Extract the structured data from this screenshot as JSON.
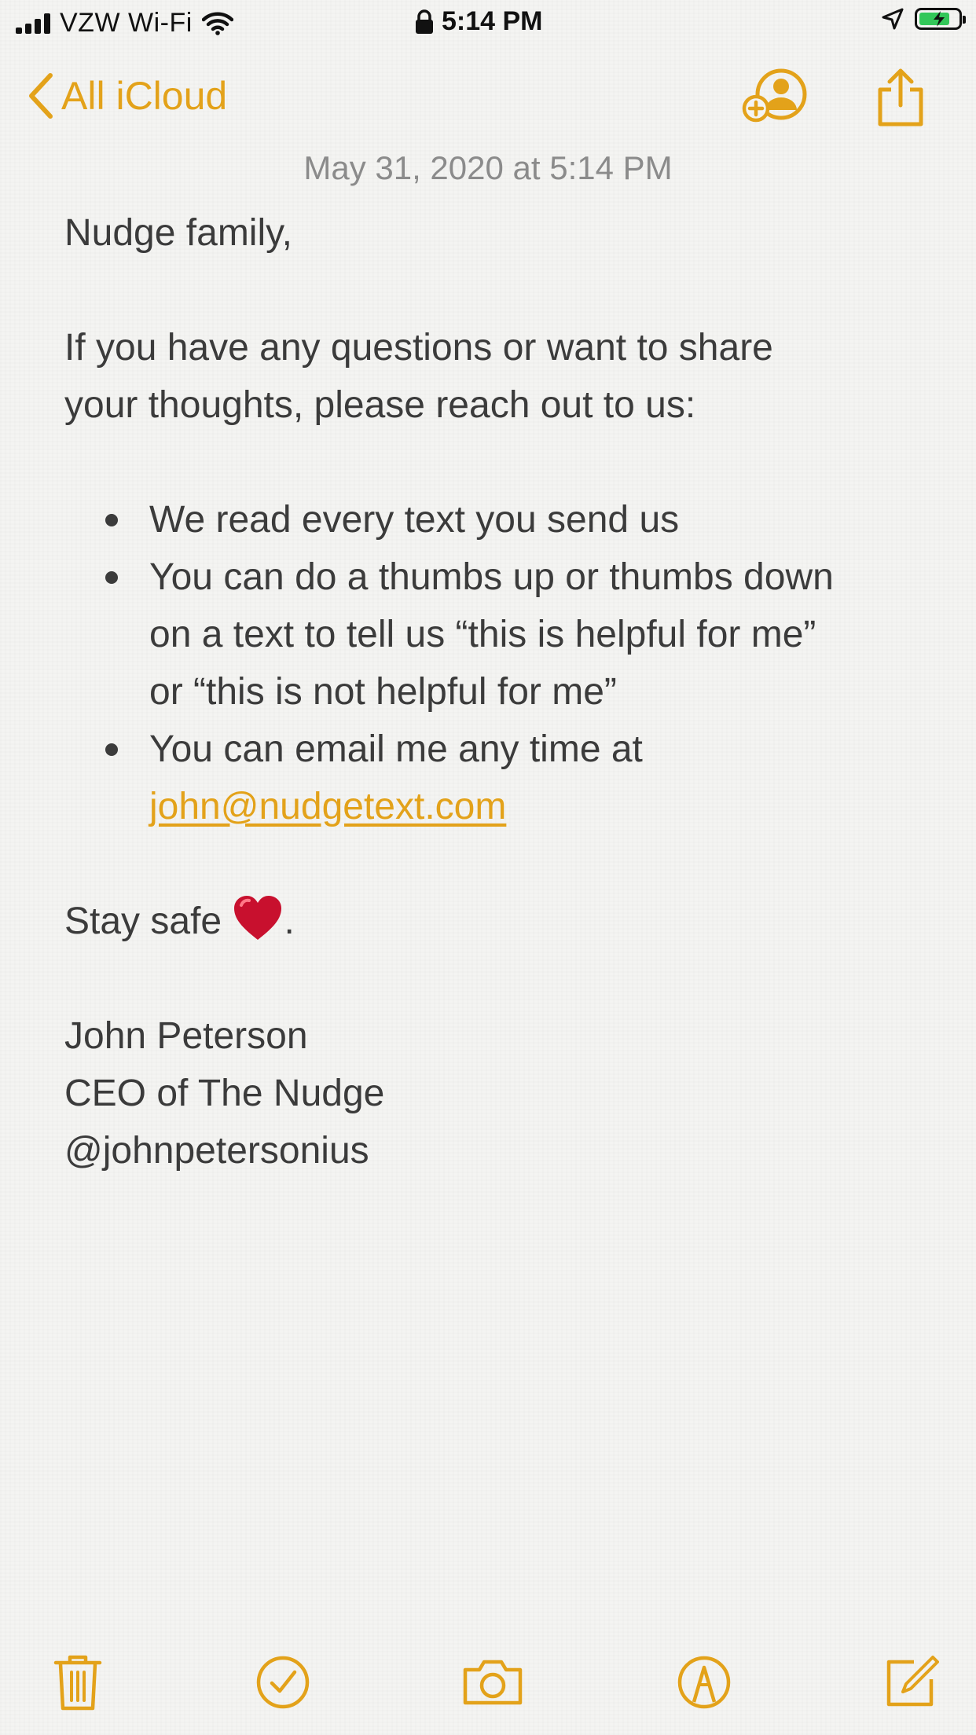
{
  "status_bar": {
    "carrier": "VZW Wi-Fi",
    "time": "5:14 PM",
    "battery_level": 0.8,
    "icons": [
      "signal-icon",
      "wifi-icon",
      "lock-icon",
      "location-icon",
      "battery-icon"
    ]
  },
  "nav": {
    "back_label": "All iCloud",
    "icons": [
      "chevron-left-icon",
      "add-people-icon",
      "share-icon"
    ]
  },
  "note": {
    "date": "May 31, 2020 at 5:14 PM",
    "greeting": "Nudge family,",
    "intro_line1": "If you have any questions or want to share",
    "intro_line2": "your thoughts, please reach out to us:",
    "bullet1": "We read every text you send us",
    "bullet2_line1": "You can do a thumbs up or thumbs down",
    "bullet2_line2": "on a text to tell us “this is helpful for me”",
    "bullet2_line3": "or “this is not helpful for me”",
    "bullet3_line1": "You can email me any time at",
    "email": "john@nudgetext.com",
    "closing": "Stay safe ",
    "closing_end": ".",
    "sig_name": "John Peterson",
    "sig_title": "CEO of The Nudge",
    "sig_handle": "@johnpetersonius"
  },
  "colors": {
    "accent": "#e3a21a",
    "text": "#3b3b3b",
    "date": "#8b8b8b",
    "background": "#f4f4f2"
  },
  "toolbar": {
    "icons": [
      "trash-icon",
      "checklist-icon",
      "camera-icon",
      "markup-icon",
      "compose-icon"
    ]
  }
}
